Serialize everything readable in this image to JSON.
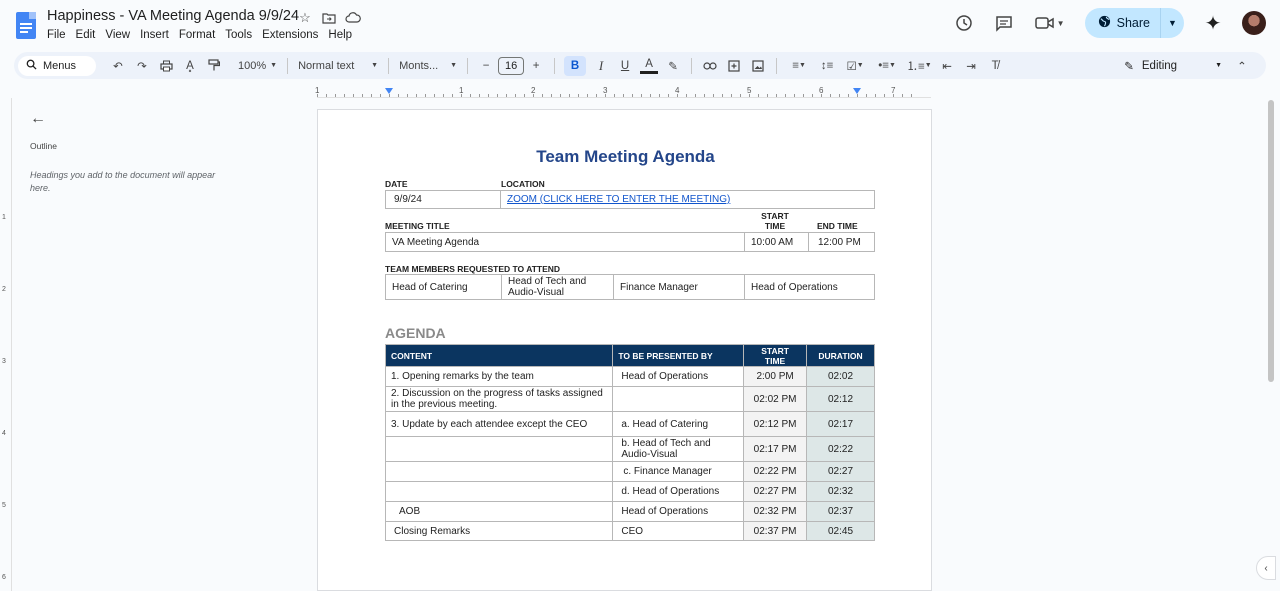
{
  "window": {
    "doc_title": "Happiness - VA Meeting Agenda 9/9/24",
    "menu": [
      "File",
      "Edit",
      "View",
      "Insert",
      "Format",
      "Tools",
      "Extensions",
      "Help"
    ],
    "share_label": "Share"
  },
  "toolbar": {
    "search_label": "Menus",
    "zoom": "100%",
    "style": "Normal text",
    "font": "Monts...",
    "font_size": "16",
    "mode": "Editing"
  },
  "ruler": {
    "numbers": [
      "1",
      "1",
      "2",
      "3",
      "4",
      "5",
      "6",
      "7"
    ]
  },
  "vruler": {
    "numbers": [
      "1",
      "2",
      "3",
      "4",
      "5",
      "6"
    ]
  },
  "outline": {
    "label": "Outline",
    "hint": "Headings you add to the document will appear here."
  },
  "doc": {
    "heading": "Team Meeting Agenda",
    "date_label": "DATE",
    "location_label": "LOCATION",
    "date_value": "9/9/24",
    "location_value": "ZOOM (CLICK HERE TO ENTER THE MEETING)",
    "meeting_title_label": "MEETING TITLE",
    "start_time_label_1": "START",
    "start_time_label_2": "TIME",
    "end_time_label": "END TIME",
    "meeting_title_value": "VA Meeting Agenda",
    "start_time_value": "10:00 AM",
    "end_time_value": "12:00 PM",
    "team_label": "TEAM MEMBERS REQUESTED TO ATTEND",
    "team_members": [
      "Head of Catering",
      "Head of Tech and\nAudio-Visual",
      "Finance Manager",
      "Head of Operations"
    ],
    "agenda_heading": "AGENDA",
    "agenda_columns": [
      "CONTENT",
      "TO BE PRESENTED BY",
      "START\nTIME",
      "DURATION"
    ],
    "agenda_rows": [
      {
        "content": "1. Opening remarks by the team",
        "presenter": "Head of Operations",
        "start": "2:00 PM",
        "duration": "02:02"
      },
      {
        "content": "2. Discussion on the progress of tasks assigned in the previous meeting.",
        "presenter": "",
        "start": "02:02 PM",
        "duration": "02:12"
      },
      {
        "content": "3. Update by each attendee except the CEO",
        "presenter": "a. Head of Catering",
        "start": "02:12 PM",
        "duration": "02:17"
      },
      {
        "content": "",
        "presenter": "b. Head of Tech and Audio-Visual",
        "start": "02:17 PM",
        "duration": "02:22"
      },
      {
        "content": "",
        "presenter": "c. Finance Manager",
        "start": "02:22 PM",
        "duration": "02:27"
      },
      {
        "content": "",
        "presenter": "d. Head of Operations",
        "start": "02:27 PM",
        "duration": "02:32"
      },
      {
        "content": "AOB",
        "presenter": "Head of Operations",
        "start": "02:32 PM",
        "duration": "02:37"
      },
      {
        "content": "Closing Remarks",
        "presenter": "CEO",
        "start": "02:37 PM",
        "duration": "02:45"
      }
    ]
  },
  "colors": {
    "accent": "#0b57d0",
    "table_header": "#0b3560",
    "heading": "#24468a"
  }
}
